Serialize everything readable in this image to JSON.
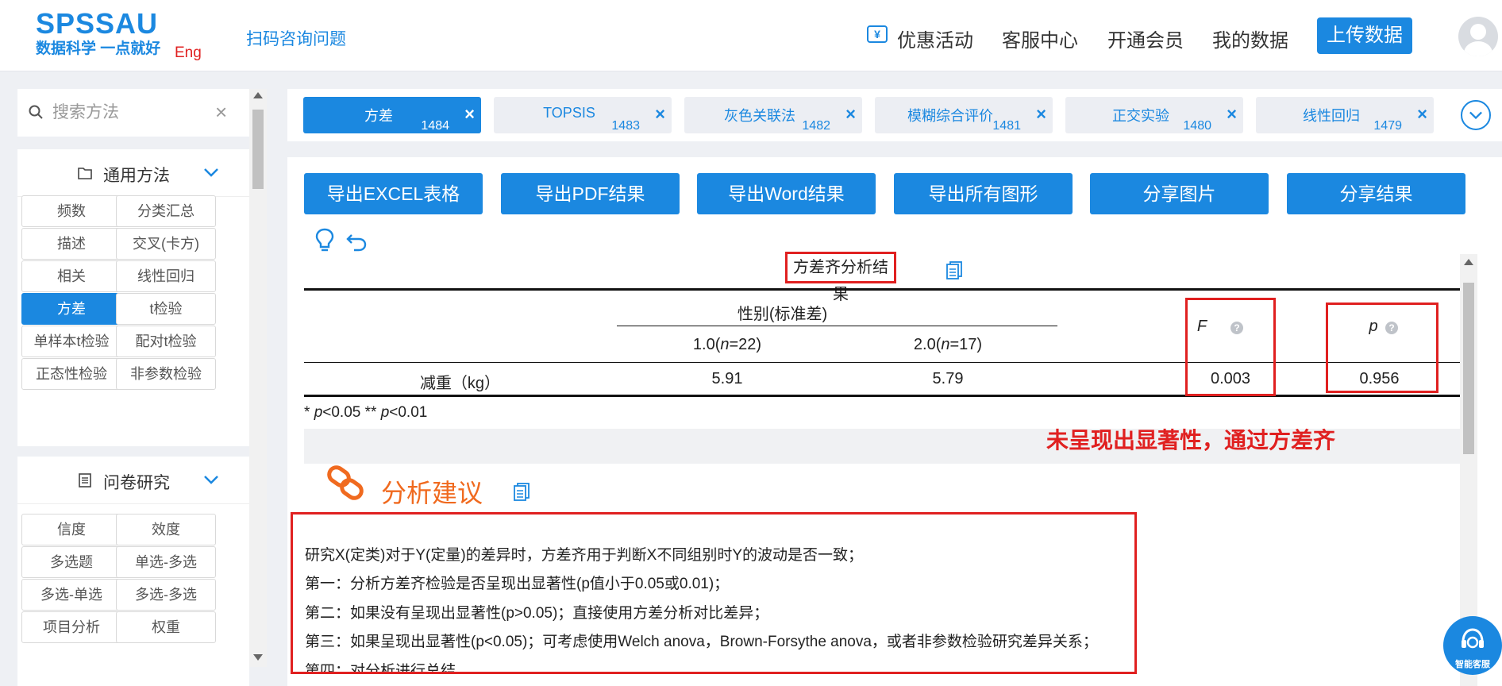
{
  "header": {
    "logo_main": "SPSSAU",
    "logo_sub": "数据科学 一点就好",
    "lang_link": "Eng",
    "scan_link": "扫码咨询问题",
    "nav": [
      {
        "label": "优惠活动",
        "icon": "coupon-icon"
      },
      {
        "label": "客服中心"
      },
      {
        "label": "开通会员"
      },
      {
        "label": "我的数据"
      }
    ],
    "upload_label": "上传数据",
    "accent_color": "#1b88e0"
  },
  "sidebar": {
    "search_placeholder": "搜索方法",
    "groups": [
      {
        "title": "通用方法",
        "items": [
          "频数",
          "分类汇总",
          "描述",
          "交叉(卡方)",
          "相关",
          "线性回归",
          "方差",
          "t检验",
          "单样本t检验",
          "配对t检验",
          "正态性检验",
          "非参数检验"
        ],
        "active": "方差"
      },
      {
        "title": "问卷研究",
        "items": [
          "信度",
          "效度",
          "多选题",
          "单选-多选",
          "多选-单选",
          "多选-多选",
          "项目分析",
          "权重"
        ]
      }
    ]
  },
  "tabs": [
    {
      "label": "方差",
      "num": "1484",
      "active": true
    },
    {
      "label": "TOPSIS",
      "num": "1483"
    },
    {
      "label": "灰色关联法",
      "num": "1482"
    },
    {
      "label": "模糊综合评价",
      "num": "1481"
    },
    {
      "label": "正交实验",
      "num": "1480"
    },
    {
      "label": "线性回归",
      "num": "1479"
    }
  ],
  "exports": [
    "导出EXCEL表格",
    "导出PDF结果",
    "导出Word结果",
    "导出所有图形",
    "分享图片",
    "分享结果"
  ],
  "result": {
    "title": "方差齐分析结果",
    "group_header": "性别(标准差)",
    "col1_level": "1.0",
    "col1_n": "n",
    "col1_count": "=22)",
    "col2_level": "2.0",
    "col2_n": "n",
    "col2_count": "=17)",
    "col_f": "F",
    "col_p": "p",
    "row_label": "减重（kg）",
    "row_values": [
      "5.91",
      "5.79",
      "0.003",
      "0.956"
    ],
    "note_a": "* ",
    "note_b": "p",
    "note_c": "<0.05 ** ",
    "note_d": "p",
    "note_e": "<0.01",
    "annotation": "未呈现出显著性，通过方差齐"
  },
  "advice": {
    "title": "分析建议",
    "lines": [
      "研究X(定类)对于Y(定量)的差异时，方差齐用于判断X不同组别时Y的波动是否一致；",
      "第一：分析方差齐检验是否呈现出显著性(p值小于0.05或0.01)；",
      "第二：如果没有呈现出显著性(p>0.05)；直接使用方差分析对比差异；",
      "第三：如果呈现出显著性(p<0.05)；可考虑使用Welch anova，Brown-Forsythe anova，或者非参数检验研究差异关系；",
      "第四：对分析进行总结。"
    ]
  },
  "service_label": "智能客服",
  "colors": {
    "accent": "#1b88e0",
    "highlight": "#e02020",
    "advice": "#f06a1f"
  }
}
